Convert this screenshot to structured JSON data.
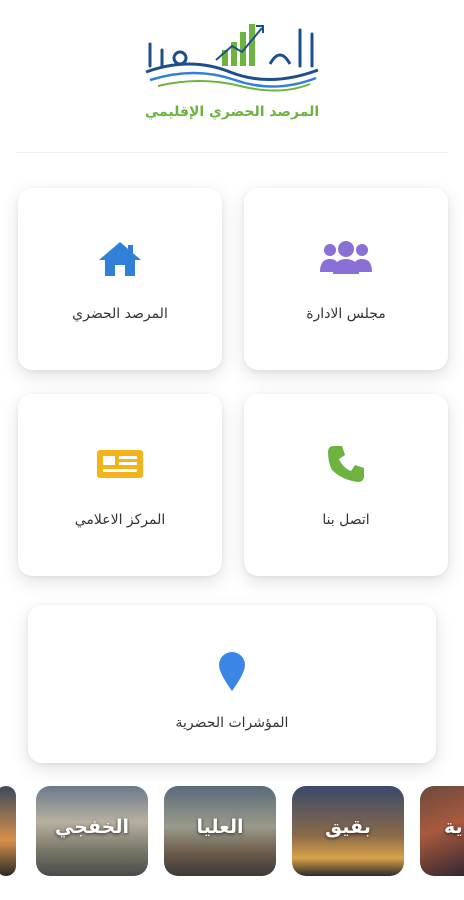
{
  "logo": {
    "title": "الشرقية",
    "subtitle": "المرصد الحضري الإقليمي",
    "colors": {
      "blue": "#1f4e8c",
      "green": "#6cb33f"
    }
  },
  "menu": {
    "board": {
      "label": "مجلس الادارة",
      "icon": "users-icon",
      "color": "#8a6fd6"
    },
    "observatory": {
      "label": "المرصد الحضري",
      "icon": "home-icon",
      "color": "#2f80d6"
    },
    "contact": {
      "label": "اتصل بنا",
      "icon": "phone-icon",
      "color": "#6cb33f"
    },
    "media": {
      "label": "المركز الاعلامي",
      "icon": "newspaper-icon",
      "color": "#f4b21b"
    },
    "indicators": {
      "label": "المؤشرات الحضرية",
      "icon": "map-pin-icon",
      "color": "#3a86e6"
    }
  },
  "cities": [
    {
      "name": "ية"
    },
    {
      "name": "بقيق"
    },
    {
      "name": "العليا"
    },
    {
      "name": "الخفجي"
    },
    {
      "name": ""
    }
  ]
}
